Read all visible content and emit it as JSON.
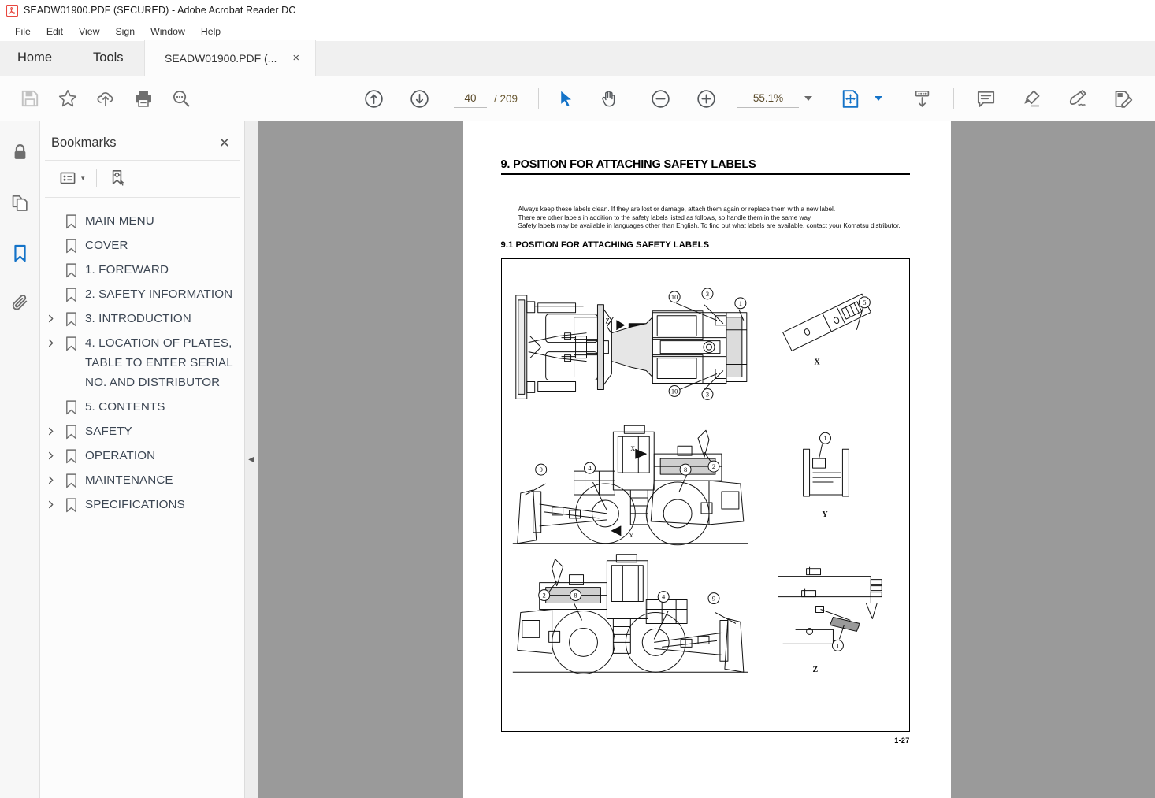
{
  "window": {
    "title": "SEADW01900.PDF (SECURED) - Adobe Acrobat Reader DC",
    "app_icon": "acrobat-logo-icon"
  },
  "menubar": {
    "items": [
      {
        "label": "File"
      },
      {
        "label": "Edit"
      },
      {
        "label": "View"
      },
      {
        "label": "Sign"
      },
      {
        "label": "Window"
      },
      {
        "label": "Help"
      }
    ]
  },
  "tabs": {
    "home_label": "Home",
    "tools_label": "Tools",
    "document_label": "SEADW01900.PDF (...",
    "close_glyph": "×"
  },
  "toolbar": {
    "left_icons": [
      {
        "name": "save-icon",
        "state": "disabled"
      },
      {
        "name": "star-icon",
        "state": "enabled"
      },
      {
        "name": "cloud-upload-icon",
        "state": "enabled"
      },
      {
        "name": "print-icon",
        "state": "enabled"
      },
      {
        "name": "search-zoom-icon",
        "state": "enabled"
      }
    ],
    "previous_page_icon": "arrow-up-circle-icon",
    "next_page_icon": "arrow-down-circle-icon",
    "page_number": "40",
    "page_total": "/ 209",
    "select_tool_icon": "cursor-arrow-icon",
    "hand_tool_icon": "hand-icon",
    "zoom_out_icon": "minus-circle-icon",
    "zoom_in_icon": "plus-circle-icon",
    "zoom_level": "55.1%",
    "fit_page_icon": "fit-page-icon",
    "scroll_mode_icon": "page-scroll-icon",
    "comment_icon": "comment-icon",
    "highlight_icon": "highlighter-icon",
    "sign_icon": "fill-and-sign-icon",
    "edit_pdf_icon": "edit-pdf-icon"
  },
  "rail": {
    "items": [
      {
        "name": "security-lock-icon",
        "label": "Security",
        "active": false
      },
      {
        "name": "page-thumbnails-icon",
        "label": "Page Thumbnails",
        "active": false
      },
      {
        "name": "bookmarks-icon",
        "label": "Bookmarks",
        "active": true
      },
      {
        "name": "attachments-icon",
        "label": "Attachments",
        "active": false
      }
    ]
  },
  "bookmarks_panel": {
    "title": "Bookmarks",
    "close_glyph": "✕",
    "options_icon": "list-options-icon",
    "options_caret": "▾",
    "new_bookmark_icon": "new-bookmark-icon",
    "items": [
      {
        "label": "MAIN MENU",
        "expandable": false
      },
      {
        "label": "COVER",
        "expandable": false
      },
      {
        "label": "1. FOREWARD",
        "expandable": false
      },
      {
        "label": "2. SAFETY INFORMATION",
        "expandable": false
      },
      {
        "label": "3. INTRODUCTION",
        "expandable": true
      },
      {
        "label": "4. LOCATION OF PLATES, TABLE TO ENTER SERIAL NO. AND DISTRIBUTOR",
        "expandable": true
      },
      {
        "label": "5. CONTENTS",
        "expandable": false
      },
      {
        "label": "SAFETY",
        "expandable": true
      },
      {
        "label": "OPERATION",
        "expandable": true
      },
      {
        "label": "MAINTENANCE",
        "expandable": true
      },
      {
        "label": "SPECIFICATIONS",
        "expandable": true
      }
    ]
  },
  "collapse_handle": {
    "glyph": "◀",
    "name": "panel-collapse-handle"
  },
  "document": {
    "heading": "9. POSITION FOR ATTACHING SAFETY LABELS",
    "paragraph_1": "Always keep these labels clean. If they are lost or damage, attach them again or replace them with a new label.",
    "paragraph_2": "There are other labels in addition to the safety labels listed as follows, so handle them in the same way.",
    "paragraph_3": "Safety labels may be available in languages other than English. To find out what labels are available, contact your Komatsu distributor.",
    "subheading": "9.1  POSITION FOR ATTACHING SAFETY LABELS",
    "page_footer": "1-27",
    "figure": {
      "description": "Wheel dozer safety label position diagrams",
      "views": [
        {
          "name": "top-view",
          "callouts": [
            "10",
            "3",
            "1",
            "10",
            "3"
          ]
        },
        {
          "name": "side-view-left",
          "callouts": [
            "9",
            "4",
            "8",
            "2"
          ]
        },
        {
          "name": "side-view-right",
          "callouts": [
            "2",
            "8",
            "4",
            "9"
          ]
        },
        {
          "name": "detail-x",
          "label": "X",
          "callouts": [
            "5"
          ]
        },
        {
          "name": "detail-y",
          "label": "Y",
          "callouts": [
            "1"
          ]
        },
        {
          "name": "detail-z",
          "label": "Z",
          "callouts": [
            "1"
          ]
        }
      ]
    }
  },
  "colors": {
    "accent_blue": "#1473c8",
    "viewer_gray": "#9a9a9a",
    "panel_bg": "#fcfcfc",
    "tab_bg": "#f0f0f0",
    "bookmark_text": "#3c4653",
    "field_text": "#5a4a2a"
  }
}
